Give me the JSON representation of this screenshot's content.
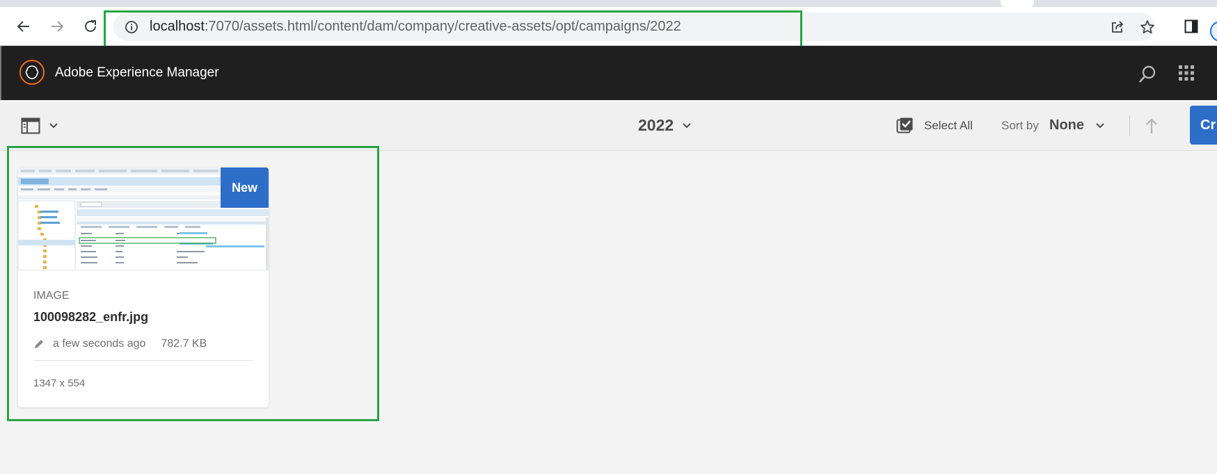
{
  "browser": {
    "url_host": "localhost",
    "url_path": ":7070/assets.html/content/dam/company/creative-assets/opt/campaigns/2022",
    "icons": [
      "back-icon",
      "forward-icon",
      "reload-icon",
      "info-icon",
      "share-icon",
      "star-icon",
      "sidepanel-icon",
      "profile-avatar"
    ]
  },
  "app": {
    "title": "Adobe Experience Manager",
    "icons": [
      "aem-logo-icon",
      "search-icon",
      "apps-grid-icon"
    ]
  },
  "actionbar": {
    "folder_title": "2022",
    "select_all_label": "Select All",
    "sort_label": "Sort by",
    "sort_value": "None",
    "create_label": "Cr"
  },
  "asset_card": {
    "badge": "New",
    "type": "IMAGE",
    "name": "100098282_enfr.jpg",
    "modified": "a few seconds ago",
    "size": "782.7 KB",
    "dimensions": "1347 x 554"
  },
  "colors": {
    "aem_header": "#1f1f1f",
    "accent_blue": "#2d6ec9",
    "highlight_green": "#27a444",
    "aem_orange": "#f26a1b"
  }
}
